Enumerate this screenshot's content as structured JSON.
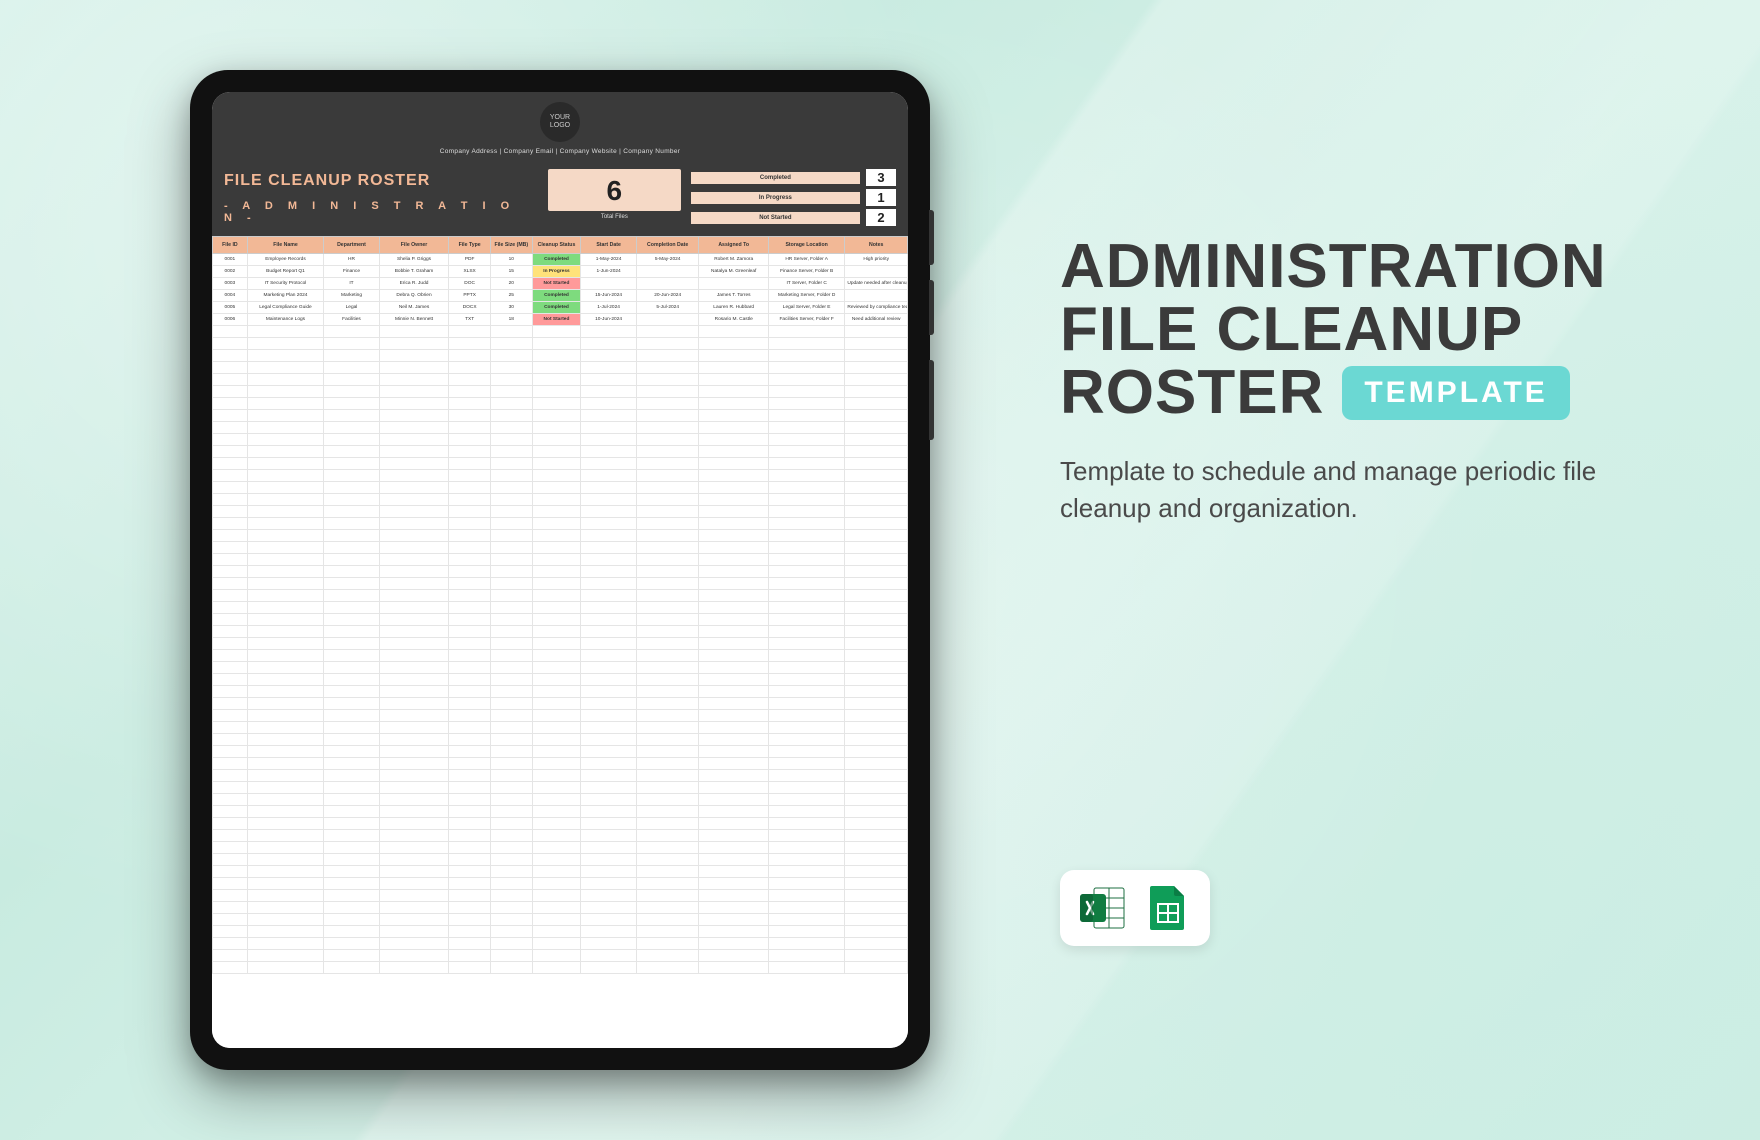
{
  "header": {
    "logo_text": "YOUR LOGO",
    "company_line": "Company Address  |  Company Email  |  Company Website  |  Company Number"
  },
  "title": {
    "main": "FILE CLEANUP ROSTER",
    "sub": "- A D M I N I S T R A T I O N -"
  },
  "totals": {
    "total_files_value": "6",
    "total_files_label": "Total Files",
    "statuses": [
      {
        "label": "Completed",
        "value": "3"
      },
      {
        "label": "In Progress",
        "value": "1"
      },
      {
        "label": "Not Started",
        "value": "2"
      }
    ]
  },
  "columns": [
    "File ID",
    "File Name",
    "Department",
    "File Owner",
    "File Type",
    "File Size (MB)",
    "Cleanup Status",
    "Start Date",
    "Completion Date",
    "Assigned To",
    "Storage Location",
    "Notes"
  ],
  "rows": [
    {
      "id": "0001",
      "name": "Employee Records",
      "dept": "HR",
      "owner": "Shelia P. Griggs",
      "type": "PDF",
      "size": "10",
      "status": "Completed",
      "start": "1-May-2024",
      "complete": "5-May-2024",
      "assigned": "Robert M. Zamora",
      "storage": "HR Server, Folder A",
      "notes": "High priority"
    },
    {
      "id": "0002",
      "name": "Budget Report Q1",
      "dept": "Finance",
      "owner": "Bobbie T. Graham",
      "type": "XLSX",
      "size": "15",
      "status": "In Progress",
      "start": "1-Jun-2024",
      "complete": "",
      "assigned": "Natalya M. Greenleaf",
      "storage": "Finance Server, Folder B",
      "notes": ""
    },
    {
      "id": "0003",
      "name": "IT Security Protocol",
      "dept": "IT",
      "owner": "Erica R. Judd",
      "type": "DOC",
      "size": "20",
      "status": "Not Started",
      "start": "",
      "complete": "",
      "assigned": "",
      "storage": "IT Server, Folder C",
      "notes": "Update needed after cleanup"
    },
    {
      "id": "0004",
      "name": "Marketing Plan 2024",
      "dept": "Marketing",
      "owner": "Debra Q. Obrien",
      "type": "PPTX",
      "size": "25",
      "status": "Completed",
      "start": "15-Jun-2024",
      "complete": "20-Jun-2024",
      "assigned": "James T. Torres",
      "storage": "Marketing Server, Folder D",
      "notes": ""
    },
    {
      "id": "0005",
      "name": "Legal Compliance Guide",
      "dept": "Legal",
      "owner": "Neil M. James",
      "type": "DOCX",
      "size": "30",
      "status": "Completed",
      "start": "1-Jul-2024",
      "complete": "5-Jul-2024",
      "assigned": "Lauren R. Hubbard",
      "storage": "Legal Server, Folder E",
      "notes": "Reviewed by compliance team"
    },
    {
      "id": "0006",
      "name": "Maintenance Logs",
      "dept": "Facilities",
      "owner": "Minnie N. Bennett",
      "type": "TXT",
      "size": "18",
      "status": "Not Started",
      "start": "10-Jun-2024",
      "complete": "",
      "assigned": "Rosario M. Castle",
      "storage": "Facilities Server, Folder F",
      "notes": "Need additional review"
    }
  ],
  "right": {
    "line1": "ADMINISTRATION",
    "line2": "FILE CLEANUP",
    "line3": "ROSTER",
    "pill": "TEMPLATE",
    "description": "Template to schedule and manage periodic file cleanup and organization."
  },
  "formats": {
    "excel": "Excel",
    "sheets": "Google Sheets"
  },
  "empty_rows": 54
}
